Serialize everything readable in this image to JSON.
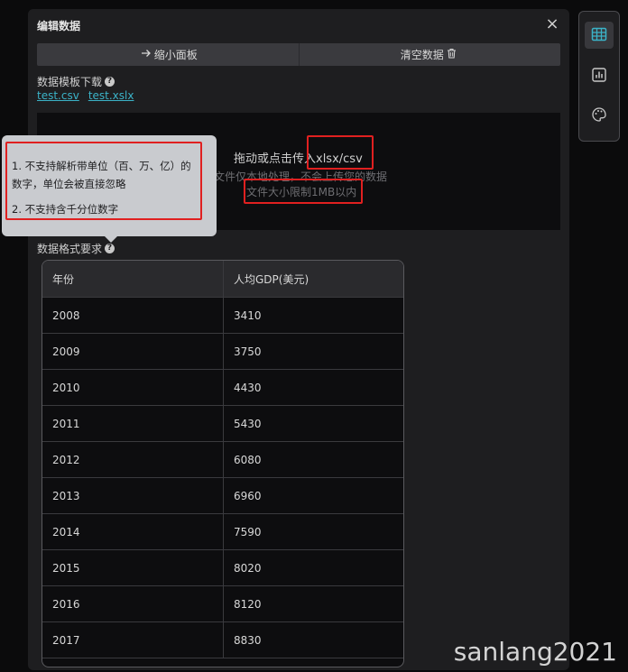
{
  "panel": {
    "title": "编辑数据",
    "close_icon": "×"
  },
  "toolbar": {
    "shrink_label": "缩小面板",
    "clear_label": "清空数据"
  },
  "template": {
    "label": "数据模板下载",
    "links": [
      "test.csv",
      "test.xslx"
    ]
  },
  "dropzone": {
    "main_text": "拖动或点击传入xlsx/csv",
    "sub_text1": "文件仅本地处理，不会上传您的数据",
    "sub_text2": "文件大小限制1MB以内"
  },
  "requirements": {
    "label": "数据格式要求"
  },
  "tooltip": {
    "line1": "1. 不支持解析带单位（百、万、亿）的数字，单位会被直接忽略",
    "line2": "2. 不支持含千分位数字"
  },
  "table": {
    "headers": [
      "年份",
      "人均GDP(美元)"
    ],
    "rows": [
      [
        "2008",
        "3410"
      ],
      [
        "2009",
        "3750"
      ],
      [
        "2010",
        "4430"
      ],
      [
        "2011",
        "5430"
      ],
      [
        "2012",
        "6080"
      ],
      [
        "2013",
        "6960"
      ],
      [
        "2014",
        "7590"
      ],
      [
        "2015",
        "8020"
      ],
      [
        "2016",
        "8120"
      ],
      [
        "2017",
        "8830"
      ]
    ]
  },
  "watermark": "sanlang2021",
  "colors": {
    "accent": "#3bb3c8",
    "highlight": "#e02020"
  }
}
